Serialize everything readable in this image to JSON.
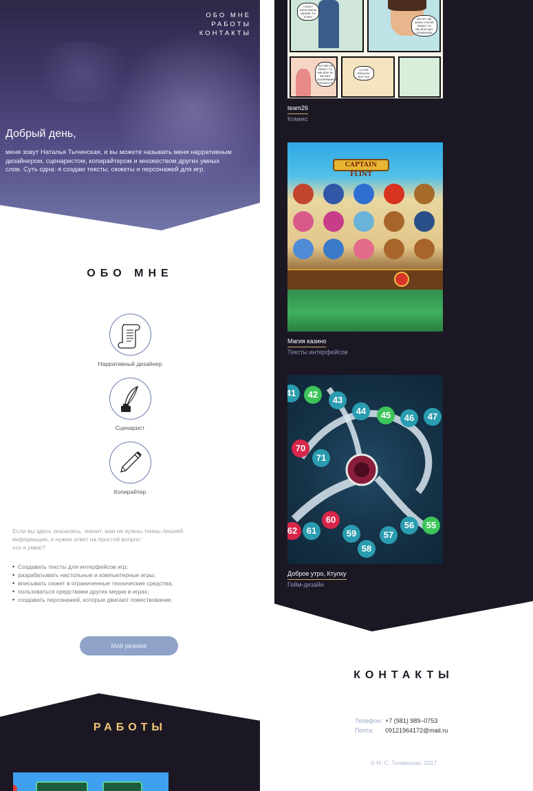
{
  "nav": [
    "ОБО МНЕ",
    "РАБОТЫ",
    "КОНТАКТЫ"
  ],
  "hero": {
    "greeting": "Добрый день,",
    "intro": "меня зовут Наталья Тычинская, и вы можете называть меня нарративным дизайнером, сценаристом, копирайтером и множеством других умных слов. Суть одна: я создаю тексты, сюжеты и персонажей для игр."
  },
  "about": {
    "title": "ОБО МНЕ",
    "roles": [
      {
        "label": "Нарративный дизайнер",
        "icon": "scroll-icon"
      },
      {
        "label": "Сценарист",
        "icon": "quill-inkwell-icon"
      },
      {
        "label": "Копирайтер",
        "icon": "pen-icon"
      }
    ],
    "lead_lines": [
      "Если вы здесь оказались, значит, вам не нужны тонны лишней",
      "информации, а нужен ответ на простой вопрос:",
      "что я умею?"
    ],
    "skills": [
      "Создавать тексты для интерфейсов игр;",
      "разрабатывать настольные и компьютерные игры;",
      "вписывать сюжет в ограниченные технические средства;",
      "пользоваться средствами других медиа в играх;",
      "создавать персонажей, которые двигают повествование."
    ],
    "resume_button": "Моё резюме"
  },
  "works": {
    "title": "РАБОТЫ",
    "items": [
      {
        "name": "team26",
        "category": "Комикс"
      },
      {
        "name": "Магия казино",
        "category": "Тексты интерфейсов"
      },
      {
        "name": "Доброе утро, Ктулху",
        "category": "Гейм-дизайн"
      }
    ],
    "comic_bubbles": [
      "I DON'T EVEN KNOW WHERE TO START",
      "NOTIFY ME WHEN YOU'RE READY TO BELIEVE ANY NONSENSE",
      "SO FAR I'M READY TO BELIEVE IN SECRET GOVERNMENT PROJECTS",
      "CLOSE ENOUGH, BUT NO!"
    ],
    "casino_title": "CAPTAIN FLINT",
    "octopus_numbers": [
      "41",
      "42",
      "43",
      "44",
      "45",
      "46",
      "47",
      "70",
      "71",
      "60",
      "62",
      "61",
      "59",
      "58",
      "57",
      "56",
      "55"
    ]
  },
  "contacts": {
    "title": "КОНТАКТЫ",
    "phone_label": "Телефон:",
    "phone": "+7 (981) 989–0753",
    "email_label": "Почта:",
    "email": "09121964172@mail.ru",
    "copyright": "© Н. С. Тычинская, 2017"
  },
  "colors": {
    "dark_bg": "#1c1823",
    "accent_gold": "#f3c77a",
    "accent_blue": "#8fa3c9",
    "hero_purple": "#514c85"
  }
}
